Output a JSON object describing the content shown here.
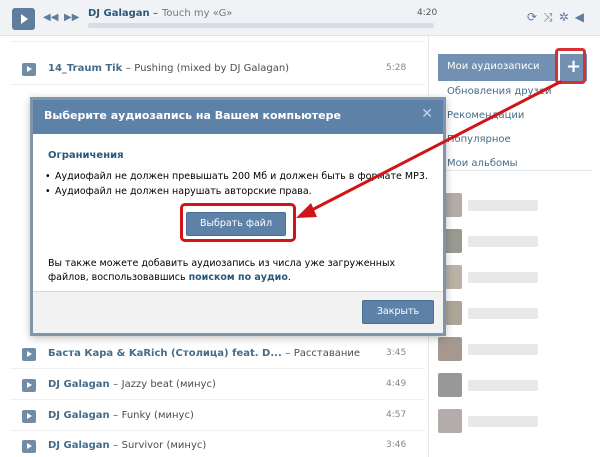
{
  "player": {
    "artist": "DJ Galagan",
    "separator": "–",
    "title": "Touch my «G»",
    "time": "4:20",
    "progress": 0
  },
  "tracks": [
    {
      "artist": "14_Traum Tik",
      "title": "Pushing (mixed by DJ Galagan)",
      "duration": "5:28"
    },
    {
      "artist": "Баста Кара & KaRich (Столица) feat. D...",
      "title": "Расставание",
      "duration": "3:45"
    },
    {
      "artist": "DJ Galagan",
      "title": "Jazzy beat (минус)",
      "duration": "4:49"
    },
    {
      "artist": "DJ Galagan",
      "title": "Funky (минус)",
      "duration": "4:57"
    },
    {
      "artist": "DJ Galagan",
      "title": "Survivor (минус)",
      "duration": "3:46"
    }
  ],
  "sidebar": {
    "active": "Мои аудиозаписи",
    "add": "+",
    "items": [
      "Обновления друзей",
      "Рекомендации",
      "Популярное",
      "Мои альбомы"
    ]
  },
  "modal": {
    "title": "Выберите аудиозапись на Вашем компьютере",
    "close_glyph": "✕",
    "section": "Ограничения",
    "rules": [
      "Аудиофайл не должен превышать 200 Мб и должен быть в формате MP3.",
      "Аудиофайл не должен нарушать авторские права."
    ],
    "choose_label": "Выбрать файл",
    "also_text": "Вы также можете добавить аудиозапись из числа уже загруженных файлов, воспользовавшись",
    "also_link": "поиском по аудио",
    "also_end": ".",
    "close_label": "Закрыть"
  },
  "colors": {
    "accent": "#5e81a8",
    "link": "#2b587a",
    "highlight": "#d01417"
  }
}
